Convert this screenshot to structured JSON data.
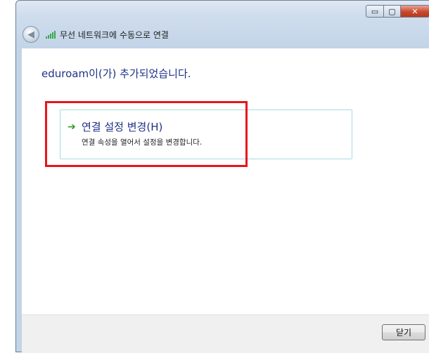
{
  "titlebar": {
    "minimize_glyph": "▭",
    "maximize_glyph": "▢",
    "close_glyph": "✕"
  },
  "nav": {
    "back_glyph": "◀",
    "title": "무선 네트워크에 수동으로 연결"
  },
  "main": {
    "headline": "eduroam이(가) 추가되었습니다.",
    "option": {
      "icon": "green-arrow-icon",
      "title": "연결 설정 변경(H)",
      "description": "연결 속성을 열어서 설정을 변경합니다."
    }
  },
  "annotation": {
    "color": "#e8141b"
  },
  "footer": {
    "close_label": "닫기"
  }
}
